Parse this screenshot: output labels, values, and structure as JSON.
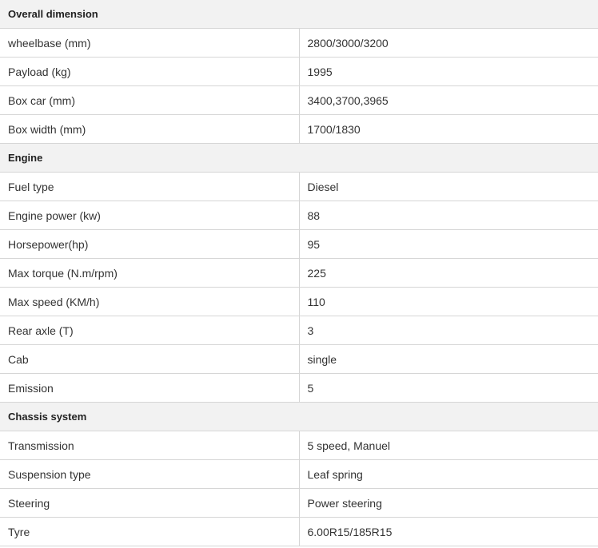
{
  "sections": [
    {
      "title": "Overall dimension",
      "rows": [
        {
          "label": "wheelbase (mm)",
          "value": "2800/3000/3200"
        },
        {
          "label": "Payload (kg)",
          "value": "1995"
        },
        {
          "label": "Box car (mm)",
          "value": "3400,3700,3965"
        },
        {
          "label": "Box width (mm)",
          "value": "1700/1830"
        }
      ]
    },
    {
      "title": "Engine",
      "rows": [
        {
          "label": "Fuel type",
          "value": "Diesel"
        },
        {
          "label": "Engine power (kw)",
          "value": "88"
        },
        {
          "label": "Horsepower(hp)",
          "value": "95"
        },
        {
          "label": "Max torque (N.m/rpm)",
          "value": "225"
        },
        {
          "label": "Max speed (KM/h)",
          "value": "110"
        },
        {
          "label": "Rear axle (T)",
          "value": "3"
        },
        {
          "label": "Cab",
          "value": "single"
        },
        {
          "label": "Emission",
          "value": "5"
        }
      ]
    },
    {
      "title": "Chassis system",
      "rows": [
        {
          "label": "Transmission",
          "value": "5 speed, Manuel"
        },
        {
          "label": "Suspension type",
          "value": "Leaf spring"
        },
        {
          "label": "Steering",
          "value": "Power steering"
        },
        {
          "label": "Tyre",
          "value": "6.00R15/185R15"
        }
      ]
    }
  ]
}
